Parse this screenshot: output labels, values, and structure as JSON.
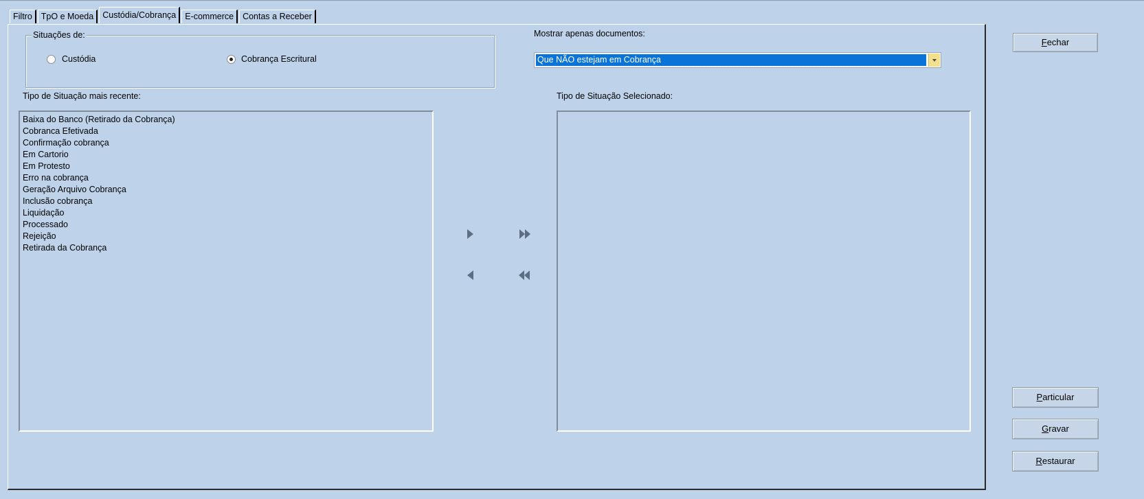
{
  "tabs": [
    "Filtro",
    "TpO e Moeda",
    "Custódia/Cobrança",
    "E-commerce",
    "Contas a Receber"
  ],
  "active_tab_index": 2,
  "situacoes": {
    "legend": "Situações de:",
    "options": [
      {
        "label": "Custódia",
        "selected": false
      },
      {
        "label": "Cobrança Escritural",
        "selected": true
      }
    ]
  },
  "mostrar": {
    "label": "Mostrar apenas documentos:",
    "selected": "Que NÃO estejam em Cobrança"
  },
  "left_list": {
    "label": "Tipo de Situação mais recente:",
    "items": [
      "Baixa do Banco (Retirado da Cobrança)",
      "Cobranca Efetivada",
      "Confirmação cobrança",
      "Em Cartorio",
      "Em Protesto",
      "Erro na cobrança",
      "Geração Arquivo Cobrança",
      "Inclusão cobrança",
      "Liquidação",
      "Processado",
      "Rejeição",
      "Retirada da Cobrança"
    ]
  },
  "right_list": {
    "label": "Tipo de Situação Selecionado:",
    "items": []
  },
  "buttons": {
    "fechar": {
      "mnemonic": "F",
      "rest": "echar"
    },
    "particular": {
      "mnemonic": "P",
      "rest": "articular"
    },
    "gravar": {
      "mnemonic": "G",
      "rest": "ravar"
    },
    "restaurar": {
      "mnemonic": "R",
      "rest": "estaurar"
    }
  },
  "icons": {
    "move_right": "triangle-right-icon",
    "move_all_right": "double-triangle-right-icon",
    "move_left": "triangle-left-icon",
    "move_all_left": "double-triangle-left-icon"
  },
  "colors": {
    "background": "#bed3ea",
    "selection": "#0a73d8",
    "combo_arrow": "#f3e08a",
    "arrow_glyph": "#5c6e80"
  }
}
